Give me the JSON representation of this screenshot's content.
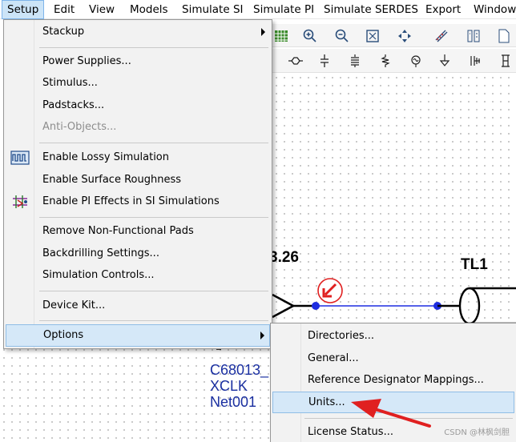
{
  "menubar": {
    "items": [
      {
        "label": "Setup",
        "open": true
      },
      {
        "label": "Edit"
      },
      {
        "label": "View"
      },
      {
        "label": "Models"
      },
      {
        "label": "Simulate SI"
      },
      {
        "label": "Simulate PI"
      },
      {
        "label": "Simulate SERDES"
      },
      {
        "label": "Export"
      },
      {
        "label": "Window"
      }
    ]
  },
  "setup_menu": {
    "items": [
      {
        "label": "Stackup",
        "submenu": true
      },
      {
        "label": "Power Supplies..."
      },
      {
        "label": "Stimulus..."
      },
      {
        "label": "Padstacks..."
      },
      {
        "label": "Anti-Objects...",
        "disabled": true
      },
      {
        "label": "Enable Lossy Simulation",
        "icon": "lossy-simulation-icon"
      },
      {
        "label": "Enable Surface Roughness"
      },
      {
        "label": "Enable PI Effects in SI Simulations",
        "icon": "pi-effects-icon"
      },
      {
        "label": "Remove Non-Functional Pads"
      },
      {
        "label": "Backdrilling Settings..."
      },
      {
        "label": "Simulation Controls..."
      },
      {
        "label": "Device Kit..."
      },
      {
        "label": "Options",
        "submenu": true,
        "highlighted": true
      }
    ]
  },
  "options_submenu": {
    "items": [
      {
        "label": "Directories..."
      },
      {
        "label": "General..."
      },
      {
        "label": "Reference Designator Mappings..."
      },
      {
        "label": "Units...",
        "highlighted": true
      },
      {
        "label": "License Status..."
      }
    ]
  },
  "schematic": {
    "value_label": "3.26",
    "tl_label": "TL1",
    "net_labels": [
      "C68013_",
      "XCLK",
      "Net001"
    ]
  },
  "watermark": "CSDN @林枫剑胆",
  "colors": {
    "menu_bg": "#f2f2f2",
    "highlight_bg": "#d5e8f8",
    "highlight_border": "#8fbde6",
    "wire": "#1e2de0",
    "annotation_red": "#e02020",
    "net_label": "#1a2fa0"
  }
}
